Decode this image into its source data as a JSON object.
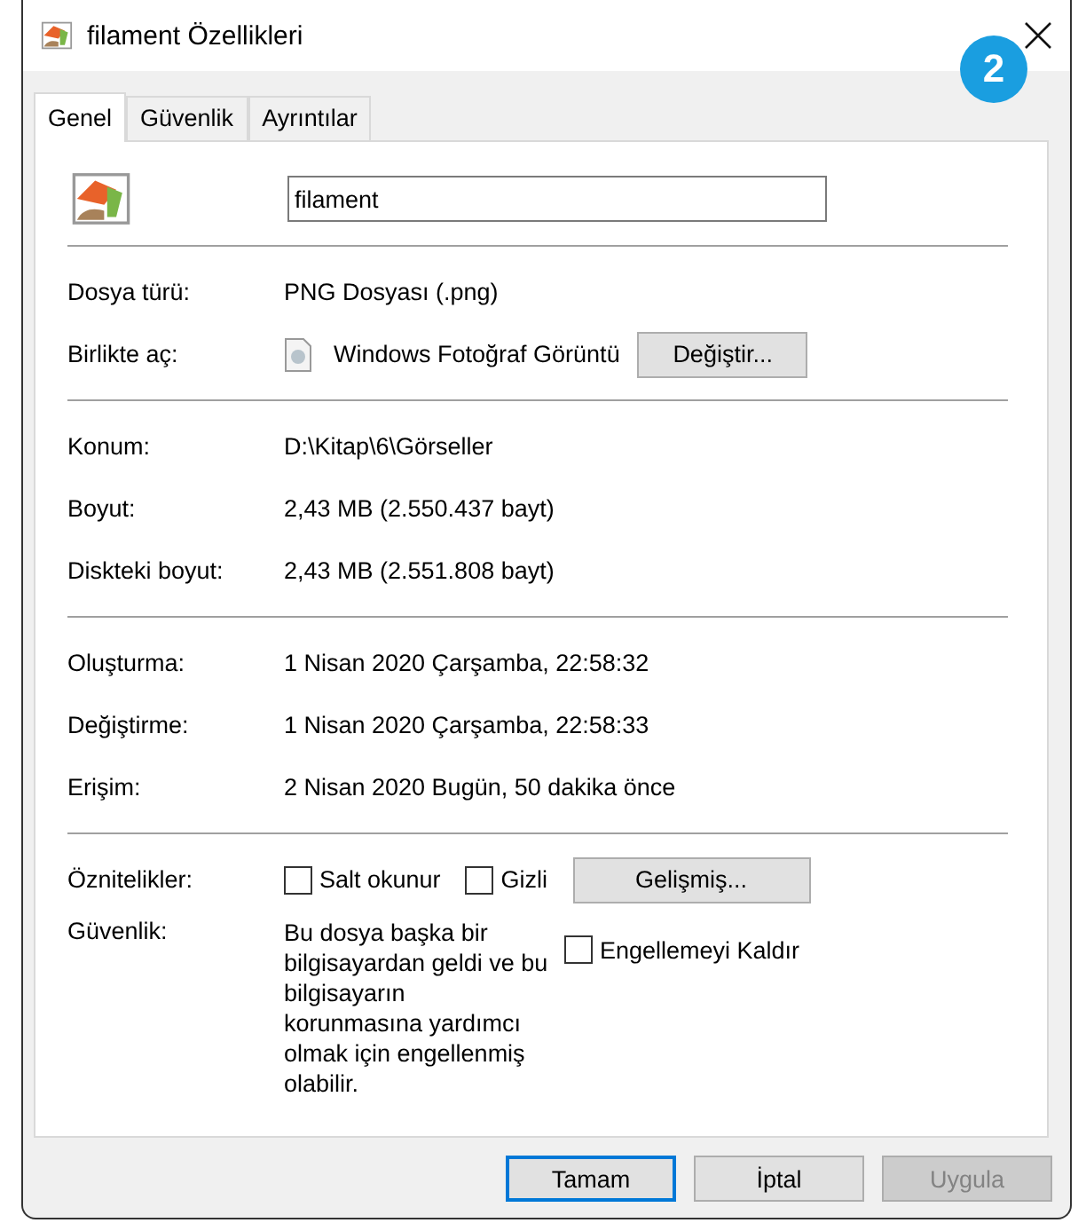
{
  "window": {
    "title": "filament Özellikleri"
  },
  "badge": "2",
  "tabs": [
    {
      "label": "Genel",
      "selected": true
    },
    {
      "label": "Güvenlik",
      "selected": false
    },
    {
      "label": "Ayrıntılar",
      "selected": false
    }
  ],
  "file_name": {
    "value": "filament"
  },
  "sections": [
    [
      {
        "kind": "text",
        "label": "Dosya türü:",
        "value": "PNG Dosyası (.png)"
      },
      {
        "kind": "open_with",
        "label": "Birlikte aç:",
        "value": "Windows Fotoğraf Görüntü",
        "button": "Değiştir..."
      }
    ],
    [
      {
        "kind": "text",
        "label": "Konum:",
        "value": "D:\\Kitap\\6\\Görseller"
      },
      {
        "kind": "text",
        "label": "Boyut:",
        "value": "2,43 MB (2.550.437 bayt)"
      },
      {
        "kind": "text",
        "label": "Diskteki boyut:",
        "value": "2,43 MB (2.551.808 bayt)"
      }
    ],
    [
      {
        "kind": "text",
        "label": "Oluşturma:",
        "value": "1 Nisan 2020 Çarşamba, 22:58:32"
      },
      {
        "kind": "text",
        "label": "Değiştirme:",
        "value": "1 Nisan 2020 Çarşamba, 22:58:33"
      },
      {
        "kind": "text",
        "label": "Erişim:",
        "value": "2 Nisan 2020 Bugün, 50 dakika önce"
      }
    ],
    [
      {
        "kind": "attributes",
        "label": "Öznitelikler:",
        "checkboxes": [
          {
            "label": "Salt okunur",
            "checked": false
          },
          {
            "label": "Gizli",
            "checked": false
          }
        ],
        "button": "Gelişmiş..."
      },
      {
        "kind": "security",
        "label": "Güvenlik:",
        "value": "Bu dosya başka bir bilgisayardan geldi ve bu bilgisayarın korunmasına yardımcı olmak için engellenmiş olabilir.",
        "checkbox": {
          "label": "Engellemeyi Kaldır",
          "checked": false
        }
      }
    ]
  ],
  "buttons": [
    {
      "label": "Tamam",
      "default": true,
      "disabled": false
    },
    {
      "label": "İptal",
      "default": false,
      "disabled": false
    },
    {
      "label": "Uygula",
      "default": false,
      "disabled": true
    }
  ]
}
